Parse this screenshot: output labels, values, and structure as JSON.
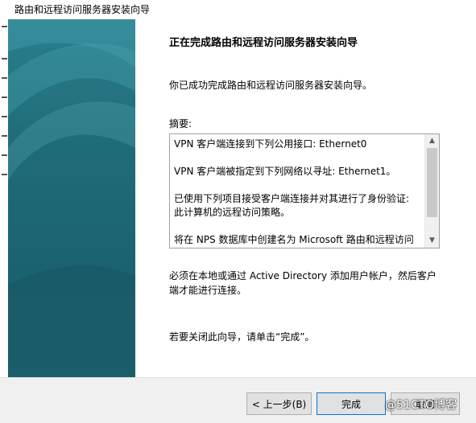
{
  "window": {
    "title": "路由和远程访问服务器安装向导"
  },
  "content": {
    "heading": "正在完成路由和远程访问服务器安装向导",
    "success_text": "你已成功完成路由和远程访问服务器安装向导。",
    "summary_label": "摘要:",
    "summary_lines": [
      "VPN 客户端连接到下列公用接口: Ethernet0",
      "VPN 客户端被指定到下列网络以寻址: Ethernet1。",
      "已使用下列项目接受客户端连接并对其进行了身份验证: 此计算机的远程访问策略。",
      "将在 NPS 数据库中创建名为 Microsoft 路由和远程访问"
    ],
    "note": "必须在本地或通过 Active Directory 添加用户帐户，然后客户端才能进行连接。",
    "close_hint": "若要关闭此向导，请单击“完成”。"
  },
  "buttons": {
    "back": "< 上一步(B)",
    "finish": "完成",
    "cancel": "取消"
  },
  "watermark": "@51CTO博客",
  "colors": {
    "banner": "#1f6c79",
    "footer": "#f0f0f0",
    "focus_border": "#0078d7"
  }
}
